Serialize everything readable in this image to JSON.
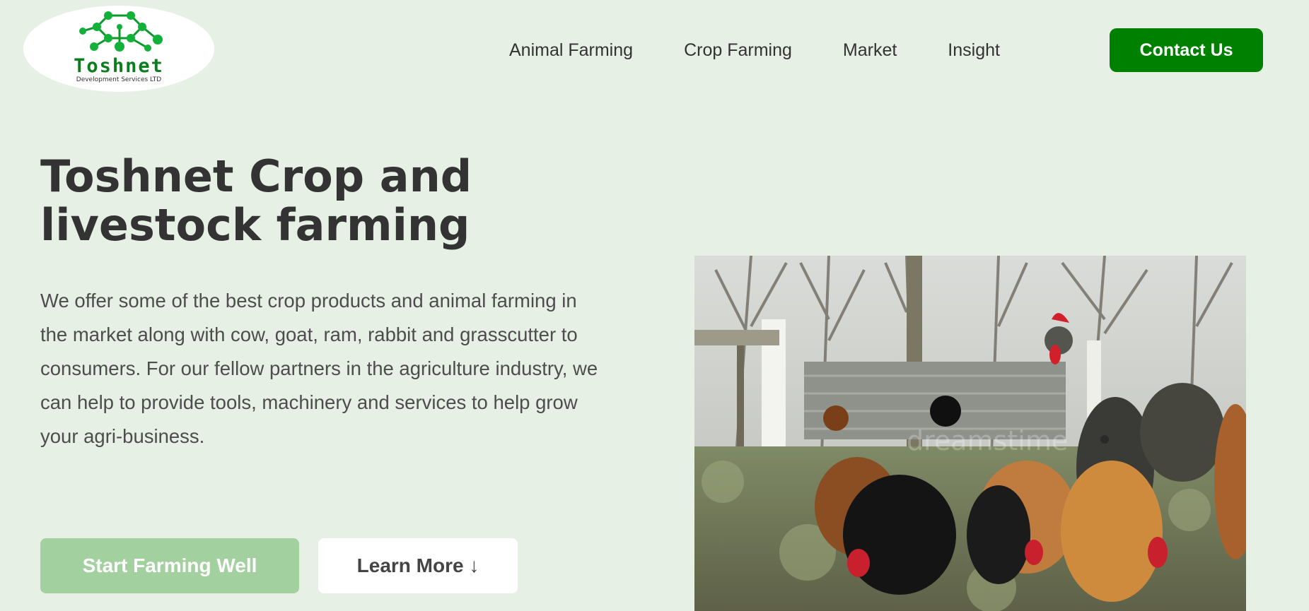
{
  "logo": {
    "word": "Toshnet",
    "subtitle": "Development Services LTD"
  },
  "nav": {
    "items": [
      "Animal Farming",
      "Crop Farming",
      "Market",
      "Insight"
    ],
    "contact_label": "Contact Us"
  },
  "hero": {
    "title_line1": "Toshnet Crop and",
    "title_line2": "livestock farming",
    "description": "We offer some of the best crop products and animal farming in the market along with cow, goat, ram, rabbit and grasscutter to consumers. For our fellow partners in the agriculture industry, we can help to provide tools, machinery and services to help grow your agri-business.",
    "primary_button": "Start Farming Well",
    "secondary_button": "Learn More ↓",
    "image_watermark": "dreamstime"
  },
  "colors": {
    "background": "#e6f0e4",
    "brand_green": "#008000",
    "primary_button_bg": "#a3d09f",
    "text_dark": "#333333"
  }
}
